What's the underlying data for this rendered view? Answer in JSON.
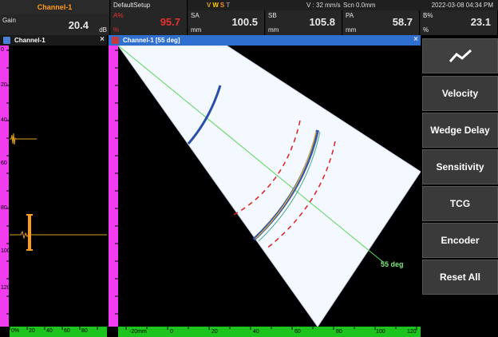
{
  "topbar": {
    "channel": "Channel-1",
    "gain_label": "Gain",
    "gain_value": "20.4",
    "gain_unit": "dB",
    "setup": "DefaultSetup",
    "vwst": {
      "v": "V",
      "w": "W",
      "s": "S",
      "t": "T"
    },
    "velocity": "V : 32 mm/s",
    "scan": "Scn 0.0mm",
    "datetime": "2022-03-08 04:34 PM",
    "a_label": "A%",
    "a_unit": "%",
    "a_value": "95.7",
    "sa_label": "SA",
    "sa_unit": "mm",
    "sa_value": "100.5",
    "sb_label": "SB",
    "sb_unit": "mm",
    "sb_value": "105.8",
    "pa_label": "PA",
    "pa_unit": "mm",
    "pa_value": "58.7",
    "b_label": "B%",
    "b_unit": "%",
    "b_value": "23.1"
  },
  "ascan": {
    "title": "Channel-1",
    "close": "×",
    "ruler_labels": [
      "0",
      "20",
      "40",
      "60",
      "80",
      "100",
      "120"
    ],
    "bottom_labels": [
      "0%",
      "20",
      "40",
      "60",
      "80"
    ]
  },
  "sscan": {
    "title": "Channel-1 [55 deg]",
    "close": "×",
    "angle_label": "55 deg",
    "bottom_labels": [
      "-20mm",
      "0",
      "20",
      "40",
      "60",
      "80",
      "100",
      "120"
    ]
  },
  "menu": {
    "items": [
      "Velocity",
      "Wedge Delay",
      "Sensitivity",
      "TCG",
      "Encoder",
      "Reset All"
    ]
  },
  "colors": {
    "channel_title": "#ff9a1a",
    "alarm_red": "#e53030",
    "ruler_magenta": "#f23cf0",
    "ruler_green": "#1ec41e",
    "sscan_header": "#2f6fd0",
    "angle_line": "#7ee87e",
    "gate_red": "#e02020",
    "ascan_trace": "#e0a020"
  }
}
